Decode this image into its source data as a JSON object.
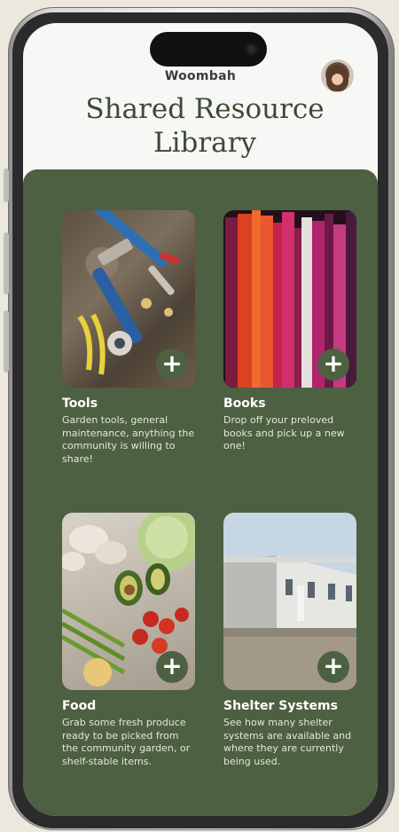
{
  "header": {
    "app_name": "Woombah",
    "title_line1": "Shared Resource",
    "title_line2": "Library"
  },
  "cards": [
    {
      "title": "Tools",
      "description": "Garden tools, general maintenance, anything the community is willing to share!",
      "add_label": "+"
    },
    {
      "title": "Books",
      "description": "Drop off your preloved books and pick up a new one!",
      "add_label": "+"
    },
    {
      "title": "Food",
      "description": "Grab some fresh produce ready to be picked from the community garden, or shelf-stable items.",
      "add_label": "+"
    },
    {
      "title": "Shelter Systems",
      "description": "See how many shelter systems are available and where they are currently being used.",
      "add_label": "+"
    }
  ],
  "colors": {
    "panel_green": "#4d6041",
    "title_text": "#3c4a36",
    "screen_bg": "#f7f7f5",
    "page_bg": "#ece8dd"
  },
  "icons": {
    "add": "plus-icon",
    "profile": "avatar"
  }
}
